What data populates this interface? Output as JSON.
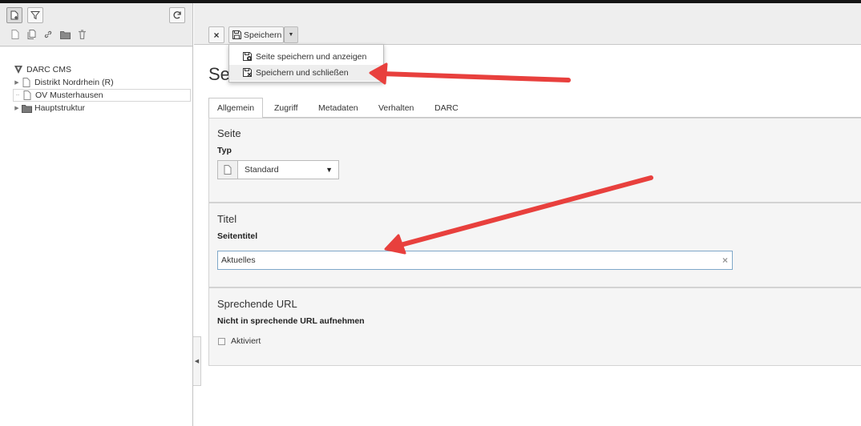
{
  "tree": {
    "root_label": "DARC CMS",
    "nodes": [
      {
        "label": "Distrikt Nordrhein (R)"
      },
      {
        "label": "OV Musterhausen"
      },
      {
        "label": "Hauptstruktur"
      }
    ]
  },
  "toolbar": {
    "close_label": "×",
    "save_label": "Speichern",
    "menu": [
      {
        "label": "Seite speichern und anzeigen"
      },
      {
        "label": "Speichern und schließen"
      }
    ]
  },
  "page": {
    "heading": "Sei"
  },
  "tabs": [
    {
      "label": "Allgemein"
    },
    {
      "label": "Zugriff"
    },
    {
      "label": "Metadaten"
    },
    {
      "label": "Verhalten"
    },
    {
      "label": "DARC"
    }
  ],
  "sections": {
    "seite": {
      "title": "Seite",
      "type_label": "Typ",
      "type_value": "Standard"
    },
    "titel": {
      "title": "Titel",
      "field_label": "Seitentitel",
      "value": "Aktuelles"
    },
    "url": {
      "title": "Sprechende URL",
      "field_label": "Nicht in sprechende URL aufnehmen",
      "checkbox_label": "Aktiviert"
    }
  },
  "colors": {
    "annotation_arrow": "#e8403d",
    "accent_focus": "#7fa8c9"
  }
}
